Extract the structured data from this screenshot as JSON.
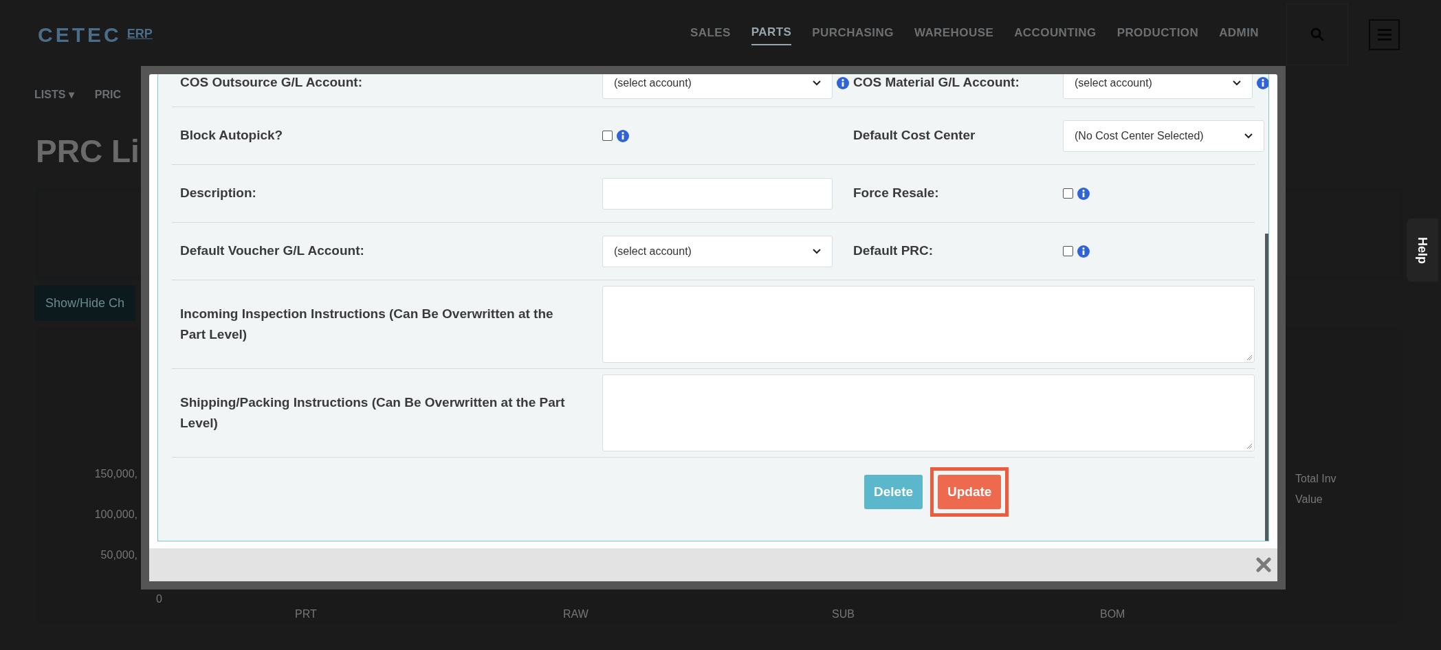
{
  "header": {
    "logo": "CETEC",
    "logo_suffix": "ERP",
    "nav": [
      {
        "label": "SALES",
        "selected": false
      },
      {
        "label": "PARTS",
        "selected": true
      },
      {
        "label": "PURCHASING",
        "selected": false
      },
      {
        "label": "WAREHOUSE",
        "selected": false
      },
      {
        "label": "ACCOUNTING",
        "selected": false
      },
      {
        "label": "PRODUCTION",
        "selected": false
      },
      {
        "label": "ADMIN",
        "selected": false
      }
    ]
  },
  "breadcrumb": [
    "LISTS ▾",
    "PRIC"
  ],
  "page_title": "PRC Li",
  "show_hide_button": "Show/Hide Ch",
  "chart_axis": {
    "y_labels": [
      "150,000,",
      "100,000,",
      "50,000,",
      "0"
    ],
    "x_labels": [
      "PRT",
      "RAW",
      "SUB",
      "BOM"
    ],
    "legend": "Total Inv Value"
  },
  "help_tab": "Help",
  "modal": {
    "rows": [
      {
        "left": {
          "label": "COS Outsource G/L Account:",
          "kind": "select",
          "value": "(select account)",
          "info": true
        },
        "right": {
          "label": "COS Material G/L Account:",
          "kind": "select",
          "value": "(select account)",
          "info": true
        }
      },
      {
        "left": {
          "label": "Block Autopick?",
          "kind": "checkbox",
          "checked": false,
          "info": true
        },
        "right": {
          "label": "Default Cost Center",
          "kind": "select",
          "value": "(No Cost Center Selected)",
          "info": false
        }
      },
      {
        "left": {
          "label": "Description:",
          "kind": "text",
          "info": false
        },
        "right": {
          "label": "Force Resale:",
          "kind": "checkbox",
          "checked": false,
          "info": true
        }
      },
      {
        "left": {
          "label": "Default Voucher G/L Account:",
          "kind": "select",
          "value": "(select account)",
          "info": false
        },
        "right": {
          "label": "Default PRC:",
          "kind": "checkbox",
          "checked": false,
          "info": true
        }
      },
      {
        "full": {
          "label": "Incoming Inspection Instructions (Can Be Overwritten at the Part Level)",
          "kind": "textarea"
        }
      },
      {
        "full": {
          "label": "Shipping/Packing Instructions (Can Be Overwritten at the Part Level)",
          "kind": "textarea"
        }
      }
    ],
    "buttons": [
      {
        "label": "Delete",
        "kind": "delete",
        "highlighted": false
      },
      {
        "label": "Update",
        "kind": "update",
        "highlighted": true
      }
    ]
  }
}
